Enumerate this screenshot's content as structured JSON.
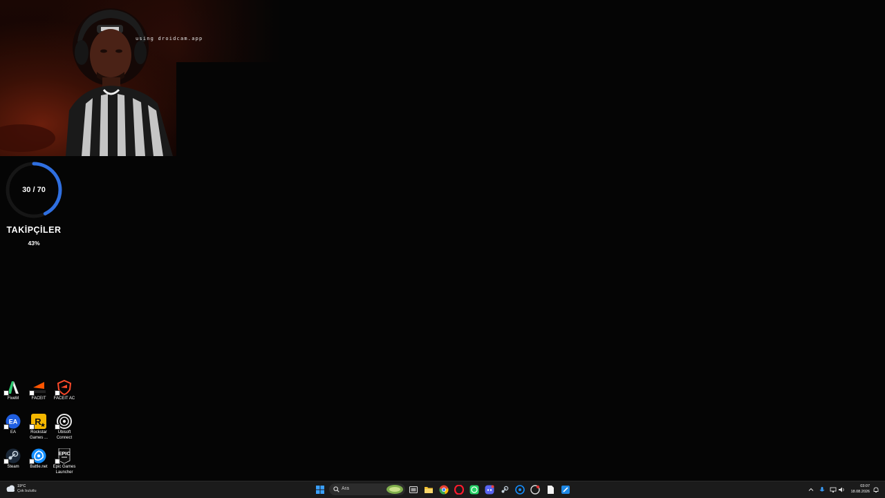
{
  "webcam": {
    "watermark": "using droidcam.app"
  },
  "progress_widget": {
    "current": 30,
    "goal": 70,
    "count_text": "30 / 70",
    "title": "TAKİPÇİLER",
    "percent_text": "43%",
    "ring_color": "#2f6fe0"
  },
  "desktop_icons": [
    {
      "label": "FiveM",
      "icon": "fivem-icon"
    },
    {
      "label": "FACEIT",
      "icon": "faceit-icon"
    },
    {
      "label": "FACEIT AC",
      "icon": "faceit-ac-icon"
    },
    {
      "label": "EA",
      "icon": "ea-icon"
    },
    {
      "label": "Rockstar Games ...",
      "icon": "rockstar-icon"
    },
    {
      "label": "Ubisoft Connect",
      "icon": "ubisoft-icon"
    },
    {
      "label": "Steam",
      "icon": "steam-icon"
    },
    {
      "label": "Battle.net",
      "icon": "battlenet-icon"
    },
    {
      "label": "Epic Games Launcher",
      "icon": "epic-games-icon"
    }
  ],
  "taskbar": {
    "weather": {
      "temp": "19°C",
      "desc": "Çok bulutlu"
    },
    "search_placeholder": "Ara",
    "pinned": [
      "windows-start-icon",
      "search-icon",
      "task-view-icon",
      "file-explorer-icon",
      "chrome-icon",
      "opera-icon",
      "whatsapp-icon",
      "discord-icon",
      "steam-icon",
      "battlenet-icon",
      "rockstar-icon",
      "notepad-icon",
      "paint-icon"
    ],
    "clock": {
      "time": "03:07",
      "date": "18.08.2026"
    }
  }
}
